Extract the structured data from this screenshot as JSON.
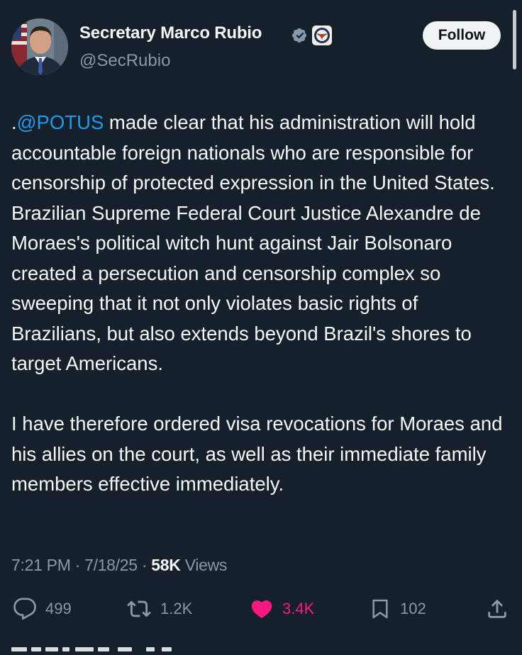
{
  "author": {
    "display_name": "Secretary Marco Rubio",
    "handle": "@SecRubio",
    "follow_label": "Follow"
  },
  "post": {
    "mention": "@POTUS",
    "paragraph1_prefix": ".",
    "paragraph1_rest": " made clear that his administration will hold accountable foreign nationals who are responsible for censorship of protected expression in the United States. Brazilian Supreme Federal Court Justice Alexandre de Moraes's political witch hunt against Jair Bolsonaro created a persecution and censorship complex so sweeping that it not only violates basic rights of Brazilians, but also extends beyond Brazil's shores to target Americans.",
    "paragraph2": "I have therefore ordered visa revocations for Moraes and his allies on the court, as well as their immediate family members effective immediately."
  },
  "meta": {
    "time": "7:21 PM",
    "separator": " · ",
    "date": "7/18/25",
    "views_count": "58K",
    "views_label": "Views"
  },
  "actions": {
    "replies": "499",
    "reposts": "1.2K",
    "likes": "3.4K",
    "bookmarks": "102"
  },
  "icons": {
    "verified": "verified-badge-icon",
    "affiliation": "state-department-seal-icon",
    "reply": "reply-icon",
    "repost": "repost-icon",
    "like": "heart-icon",
    "bookmark": "bookmark-icon",
    "share": "share-icon"
  },
  "colors": {
    "background": "#15202b",
    "text": "#f7f9f9",
    "secondary_text": "#8b98a5",
    "mention": "#1d9bf0",
    "like": "#f91880",
    "follow_button_bg": "#eff3f4",
    "verified_badge": "#829aab"
  }
}
